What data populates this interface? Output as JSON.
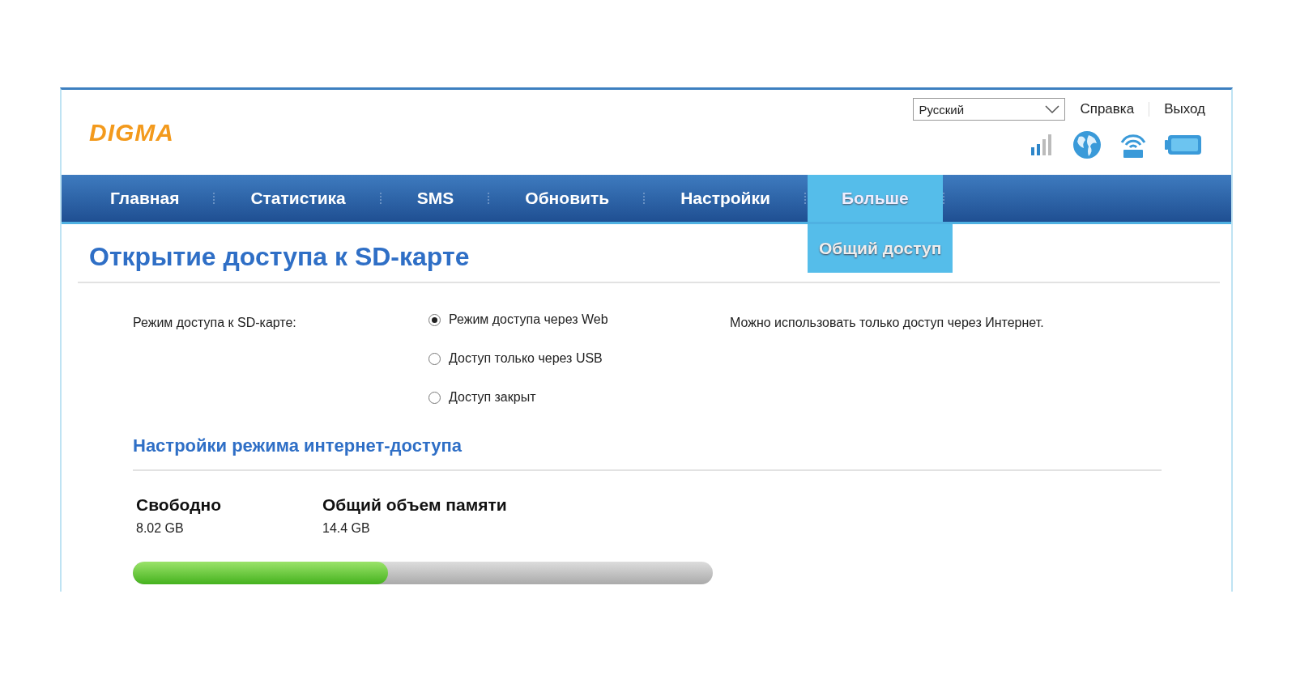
{
  "logo": "DIGMA",
  "language_select": {
    "value": "Русский"
  },
  "header_links": [
    "Справка",
    "Выход"
  ],
  "nav": [
    {
      "label": "Главная",
      "selected": false
    },
    {
      "label": "Статистика",
      "selected": false
    },
    {
      "label": "SMS",
      "selected": false
    },
    {
      "label": "Обновить",
      "selected": false
    },
    {
      "label": "Настройки",
      "selected": false
    },
    {
      "label": "Больше",
      "selected": true
    }
  ],
  "submenu": [
    {
      "label": "Общий доступ",
      "selected": true
    }
  ],
  "page_title": "Открытие доступа к SD-карте",
  "access_mode": {
    "label": "Режим доступа к SD-карте:",
    "options": [
      {
        "label": "Режим доступа через Web",
        "selected": true
      },
      {
        "label": "Доступ только через USB",
        "selected": false
      },
      {
        "label": "Доступ закрыт",
        "selected": false
      }
    ],
    "note": "Можно использовать только доступ через Интернет."
  },
  "section_title": "Настройки режима интернет-доступа",
  "storage": {
    "free_label": "Свободно",
    "free_value": "8.02 GB",
    "total_label": "Общий объем памяти",
    "total_value": "14.4 GB",
    "level": 0.44
  }
}
